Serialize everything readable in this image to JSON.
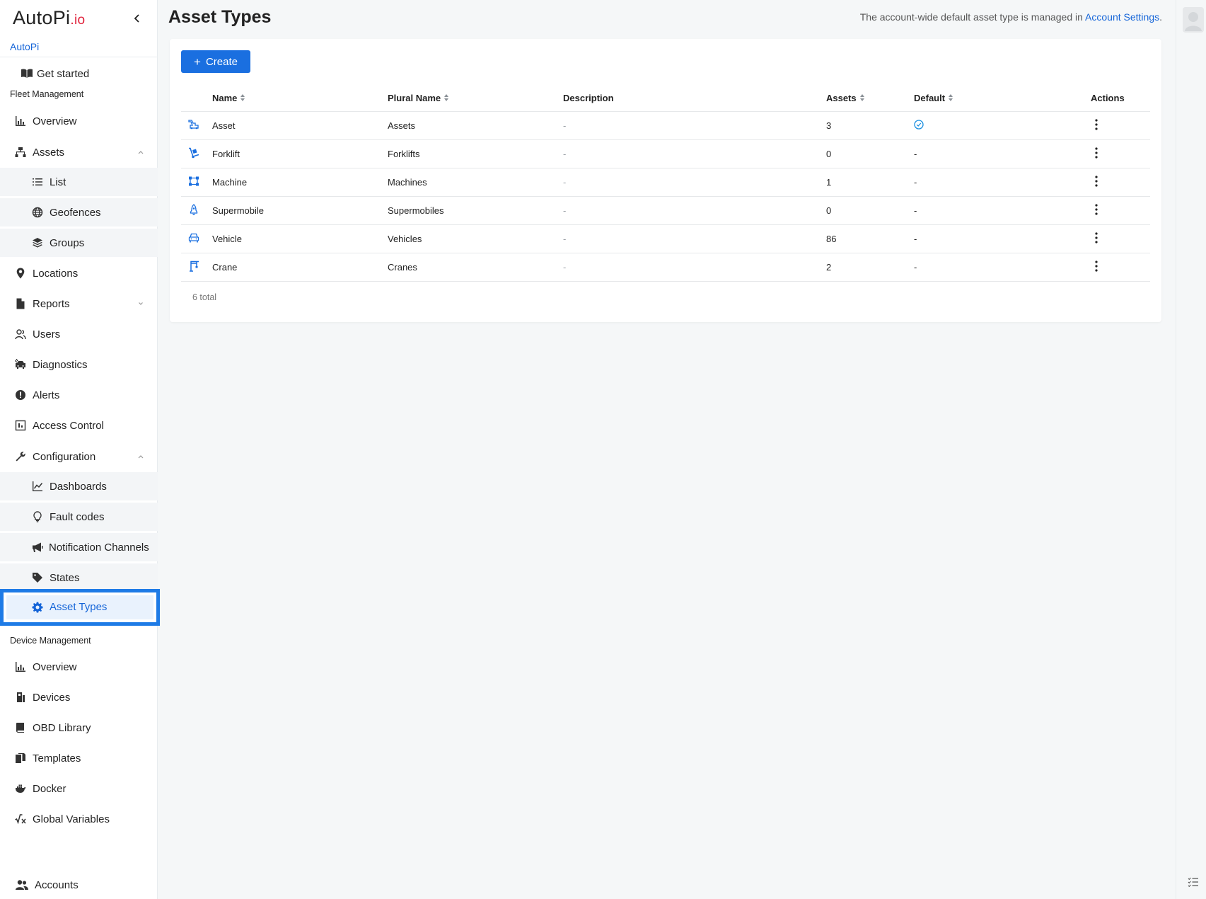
{
  "brand": {
    "logo_text": "AutoPi",
    "logo_suffix": ".io",
    "account": "AutoPi"
  },
  "sidebar": {
    "get_started": "Get started",
    "fleet_section": "Fleet Management",
    "fleet": {
      "overview": "Overview",
      "assets": "Assets",
      "list": "List",
      "geofences": "Geofences",
      "groups": "Groups",
      "locations": "Locations",
      "reports": "Reports",
      "users": "Users",
      "diagnostics": "Diagnostics",
      "alerts": "Alerts",
      "access_control": "Access Control",
      "configuration": "Configuration",
      "dashboards": "Dashboards",
      "fault_codes": "Fault codes",
      "notification_channels": "Notification Channels",
      "states": "States",
      "asset_types": "Asset Types"
    },
    "device_section": "Device Management",
    "device": {
      "overview": "Overview",
      "devices": "Devices",
      "obd_library": "OBD Library",
      "templates": "Templates",
      "docker": "Docker",
      "global_variables": "Global Variables"
    },
    "accounts": "Accounts"
  },
  "header": {
    "title": "Asset Types",
    "hint_prefix": "The account-wide default asset type is managed in",
    "hint_link": "Account Settings",
    "hint_suffix": "."
  },
  "toolbar": {
    "create_label": "Create"
  },
  "table": {
    "columns": {
      "name": "Name",
      "plural": "Plural Name",
      "description": "Description",
      "assets": "Assets",
      "default": "Default",
      "actions": "Actions"
    },
    "rows": [
      {
        "icon": "excavator-icon",
        "name": "Asset",
        "plural": "Assets",
        "description": "-",
        "assets": "3",
        "default": "check-circle-icon"
      },
      {
        "icon": "hand-truck-icon",
        "name": "Forklift",
        "plural": "Forklifts",
        "description": "-",
        "assets": "0",
        "default": "-"
      },
      {
        "icon": "machine-icon",
        "name": "Machine",
        "plural": "Machines",
        "description": "-",
        "assets": "1",
        "default": "-"
      },
      {
        "icon": "rocket-icon",
        "name": "Supermobile",
        "plural": "Supermobiles",
        "description": "-",
        "assets": "0",
        "default": "-"
      },
      {
        "icon": "car-icon",
        "name": "Vehicle",
        "plural": "Vehicles",
        "description": "-",
        "assets": "86",
        "default": "-"
      },
      {
        "icon": "crane-icon",
        "name": "Crane",
        "plural": "Cranes",
        "description": "-",
        "assets": "2",
        "default": "-"
      }
    ],
    "total": "6 total"
  },
  "colors": {
    "accent": "#1a6fe0",
    "link": "#1565d8",
    "logo_io": "#e0203a",
    "active_outline": "#1e7be6"
  }
}
